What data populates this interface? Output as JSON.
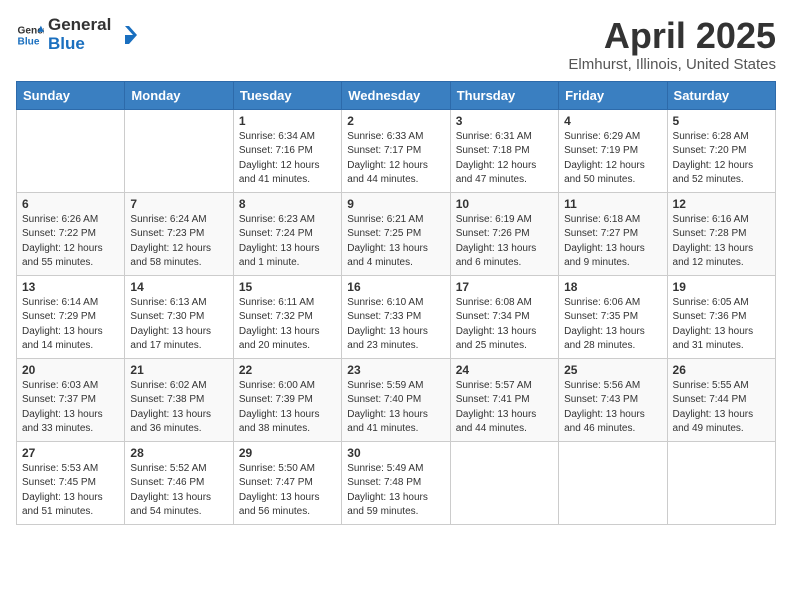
{
  "header": {
    "logo_general": "General",
    "logo_blue": "Blue",
    "title": "April 2025",
    "subtitle": "Elmhurst, Illinois, United States"
  },
  "weekdays": [
    "Sunday",
    "Monday",
    "Tuesday",
    "Wednesday",
    "Thursday",
    "Friday",
    "Saturday"
  ],
  "weeks": [
    [
      {
        "day": "",
        "sunrise": "",
        "sunset": "",
        "daylight": ""
      },
      {
        "day": "",
        "sunrise": "",
        "sunset": "",
        "daylight": ""
      },
      {
        "day": "1",
        "sunrise": "Sunrise: 6:34 AM",
        "sunset": "Sunset: 7:16 PM",
        "daylight": "Daylight: 12 hours and 41 minutes."
      },
      {
        "day": "2",
        "sunrise": "Sunrise: 6:33 AM",
        "sunset": "Sunset: 7:17 PM",
        "daylight": "Daylight: 12 hours and 44 minutes."
      },
      {
        "day": "3",
        "sunrise": "Sunrise: 6:31 AM",
        "sunset": "Sunset: 7:18 PM",
        "daylight": "Daylight: 12 hours and 47 minutes."
      },
      {
        "day": "4",
        "sunrise": "Sunrise: 6:29 AM",
        "sunset": "Sunset: 7:19 PM",
        "daylight": "Daylight: 12 hours and 50 minutes."
      },
      {
        "day": "5",
        "sunrise": "Sunrise: 6:28 AM",
        "sunset": "Sunset: 7:20 PM",
        "daylight": "Daylight: 12 hours and 52 minutes."
      }
    ],
    [
      {
        "day": "6",
        "sunrise": "Sunrise: 6:26 AM",
        "sunset": "Sunset: 7:22 PM",
        "daylight": "Daylight: 12 hours and 55 minutes."
      },
      {
        "day": "7",
        "sunrise": "Sunrise: 6:24 AM",
        "sunset": "Sunset: 7:23 PM",
        "daylight": "Daylight: 12 hours and 58 minutes."
      },
      {
        "day": "8",
        "sunrise": "Sunrise: 6:23 AM",
        "sunset": "Sunset: 7:24 PM",
        "daylight": "Daylight: 13 hours and 1 minute."
      },
      {
        "day": "9",
        "sunrise": "Sunrise: 6:21 AM",
        "sunset": "Sunset: 7:25 PM",
        "daylight": "Daylight: 13 hours and 4 minutes."
      },
      {
        "day": "10",
        "sunrise": "Sunrise: 6:19 AM",
        "sunset": "Sunset: 7:26 PM",
        "daylight": "Daylight: 13 hours and 6 minutes."
      },
      {
        "day": "11",
        "sunrise": "Sunrise: 6:18 AM",
        "sunset": "Sunset: 7:27 PM",
        "daylight": "Daylight: 13 hours and 9 minutes."
      },
      {
        "day": "12",
        "sunrise": "Sunrise: 6:16 AM",
        "sunset": "Sunset: 7:28 PM",
        "daylight": "Daylight: 13 hours and 12 minutes."
      }
    ],
    [
      {
        "day": "13",
        "sunrise": "Sunrise: 6:14 AM",
        "sunset": "Sunset: 7:29 PM",
        "daylight": "Daylight: 13 hours and 14 minutes."
      },
      {
        "day": "14",
        "sunrise": "Sunrise: 6:13 AM",
        "sunset": "Sunset: 7:30 PM",
        "daylight": "Daylight: 13 hours and 17 minutes."
      },
      {
        "day": "15",
        "sunrise": "Sunrise: 6:11 AM",
        "sunset": "Sunset: 7:32 PM",
        "daylight": "Daylight: 13 hours and 20 minutes."
      },
      {
        "day": "16",
        "sunrise": "Sunrise: 6:10 AM",
        "sunset": "Sunset: 7:33 PM",
        "daylight": "Daylight: 13 hours and 23 minutes."
      },
      {
        "day": "17",
        "sunrise": "Sunrise: 6:08 AM",
        "sunset": "Sunset: 7:34 PM",
        "daylight": "Daylight: 13 hours and 25 minutes."
      },
      {
        "day": "18",
        "sunrise": "Sunrise: 6:06 AM",
        "sunset": "Sunset: 7:35 PM",
        "daylight": "Daylight: 13 hours and 28 minutes."
      },
      {
        "day": "19",
        "sunrise": "Sunrise: 6:05 AM",
        "sunset": "Sunset: 7:36 PM",
        "daylight": "Daylight: 13 hours and 31 minutes."
      }
    ],
    [
      {
        "day": "20",
        "sunrise": "Sunrise: 6:03 AM",
        "sunset": "Sunset: 7:37 PM",
        "daylight": "Daylight: 13 hours and 33 minutes."
      },
      {
        "day": "21",
        "sunrise": "Sunrise: 6:02 AM",
        "sunset": "Sunset: 7:38 PM",
        "daylight": "Daylight: 13 hours and 36 minutes."
      },
      {
        "day": "22",
        "sunrise": "Sunrise: 6:00 AM",
        "sunset": "Sunset: 7:39 PM",
        "daylight": "Daylight: 13 hours and 38 minutes."
      },
      {
        "day": "23",
        "sunrise": "Sunrise: 5:59 AM",
        "sunset": "Sunset: 7:40 PM",
        "daylight": "Daylight: 13 hours and 41 minutes."
      },
      {
        "day": "24",
        "sunrise": "Sunrise: 5:57 AM",
        "sunset": "Sunset: 7:41 PM",
        "daylight": "Daylight: 13 hours and 44 minutes."
      },
      {
        "day": "25",
        "sunrise": "Sunrise: 5:56 AM",
        "sunset": "Sunset: 7:43 PM",
        "daylight": "Daylight: 13 hours and 46 minutes."
      },
      {
        "day": "26",
        "sunrise": "Sunrise: 5:55 AM",
        "sunset": "Sunset: 7:44 PM",
        "daylight": "Daylight: 13 hours and 49 minutes."
      }
    ],
    [
      {
        "day": "27",
        "sunrise": "Sunrise: 5:53 AM",
        "sunset": "Sunset: 7:45 PM",
        "daylight": "Daylight: 13 hours and 51 minutes."
      },
      {
        "day": "28",
        "sunrise": "Sunrise: 5:52 AM",
        "sunset": "Sunset: 7:46 PM",
        "daylight": "Daylight: 13 hours and 54 minutes."
      },
      {
        "day": "29",
        "sunrise": "Sunrise: 5:50 AM",
        "sunset": "Sunset: 7:47 PM",
        "daylight": "Daylight: 13 hours and 56 minutes."
      },
      {
        "day": "30",
        "sunrise": "Sunrise: 5:49 AM",
        "sunset": "Sunset: 7:48 PM",
        "daylight": "Daylight: 13 hours and 59 minutes."
      },
      {
        "day": "",
        "sunrise": "",
        "sunset": "",
        "daylight": ""
      },
      {
        "day": "",
        "sunrise": "",
        "sunset": "",
        "daylight": ""
      },
      {
        "day": "",
        "sunrise": "",
        "sunset": "",
        "daylight": ""
      }
    ]
  ]
}
